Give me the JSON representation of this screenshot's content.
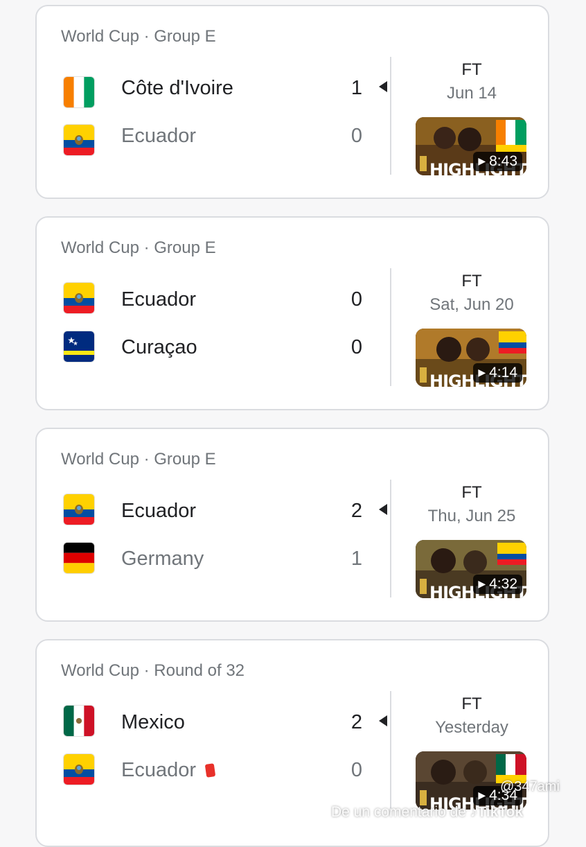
{
  "matches": [
    {
      "competition": "World Cup · Group E",
      "status": "FT",
      "date": "Jun 14",
      "highlight_duration": "8:43",
      "home": {
        "name": "Côte d'Ivoire",
        "score": "1",
        "flag": "flag-cote-divoire"
      },
      "away": {
        "name": "Ecuador",
        "score": "0",
        "flag": "flag-ecuador"
      }
    },
    {
      "competition": "World Cup · Group E",
      "status": "FT",
      "date": "Sat, Jun 20",
      "highlight_duration": "4:14",
      "home": {
        "name": "Ecuador",
        "score": "0",
        "flag": "flag-ecuador"
      },
      "away": {
        "name": "Curaçao",
        "score": "0",
        "flag": "flag-curacao"
      }
    },
    {
      "competition": "World Cup · Group E",
      "status": "FT",
      "date": "Thu, Jun 25",
      "highlight_duration": "4:32",
      "home": {
        "name": "Ecuador",
        "score": "2",
        "flag": "flag-ecuador"
      },
      "away": {
        "name": "Germany",
        "score": "1",
        "flag": "flag-germany"
      }
    },
    {
      "competition": "World Cup · Round of 32",
      "status": "FT",
      "date": "Yesterday",
      "highlight_duration": "4:34",
      "home": {
        "name": "Mexico",
        "score": "2",
        "flag": "flag-mexico"
      },
      "away": {
        "name": "Ecuador",
        "score": "0",
        "flag": "flag-ecuador",
        "red_card": true
      }
    }
  ],
  "thumbnail_text": "HIGHLIGHTS",
  "watermark": {
    "prefix": "De un comentario de",
    "brand": "TikTok",
    "user": "@347ami"
  },
  "colors": {
    "primary_text": "#202124",
    "secondary_text": "#70757a",
    "border": "#dadce0",
    "red_card": "#e8312a"
  }
}
